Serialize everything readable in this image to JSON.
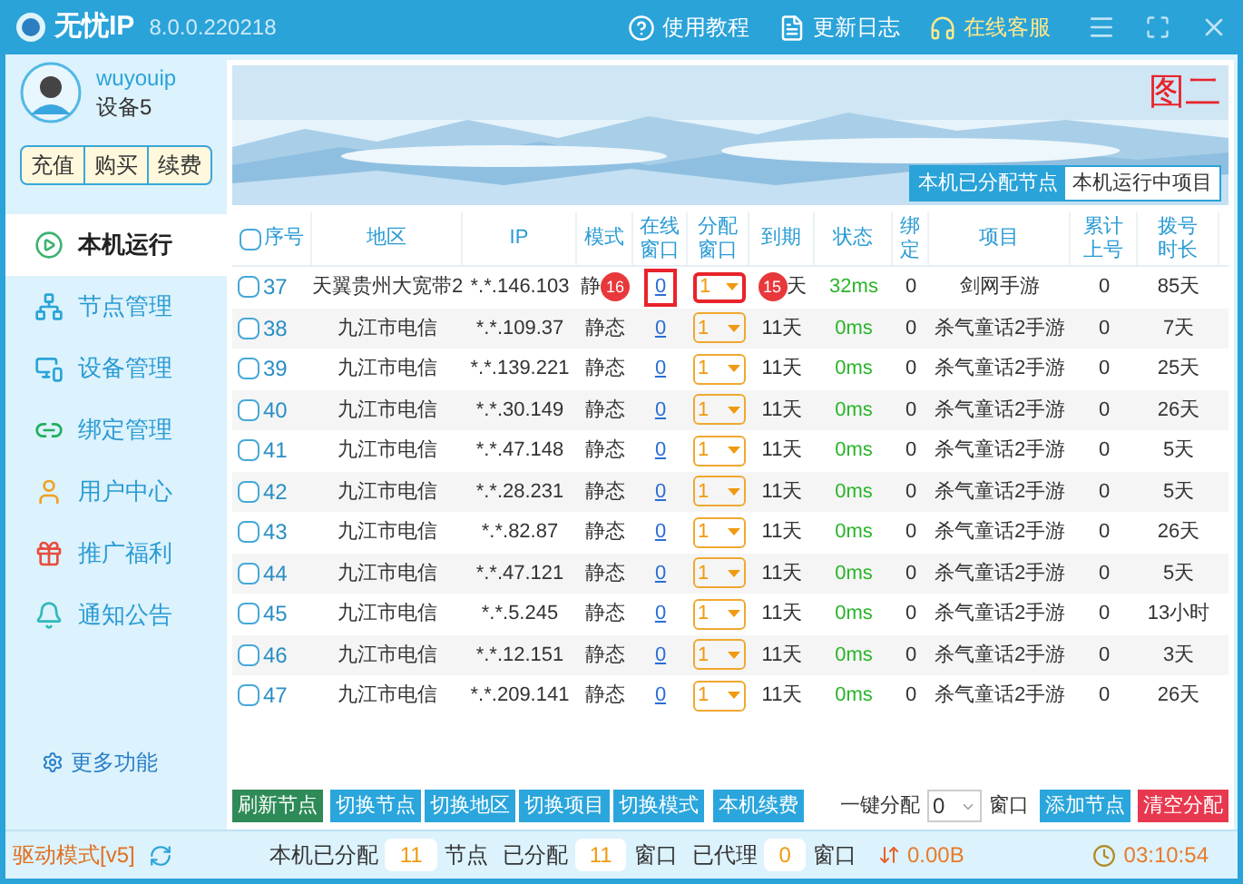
{
  "window": {
    "title": "无忧IP",
    "version": "8.0.0.220218",
    "links": [
      {
        "kind": "help",
        "label": "使用教程"
      },
      {
        "kind": "log",
        "label": "更新日志"
      },
      {
        "kind": "service",
        "label": "在线客服"
      }
    ]
  },
  "user": {
    "name": "wuyouip",
    "device": "设备5",
    "actions": [
      "充值",
      "购买",
      "续费"
    ]
  },
  "sidebar": {
    "items": [
      {
        "kind": "play",
        "label": "本机运行",
        "selected": true
      },
      {
        "kind": "nodes",
        "label": "节点管理",
        "selected": false
      },
      {
        "kind": "device",
        "label": "设备管理",
        "selected": false
      },
      {
        "kind": "bind",
        "label": "绑定管理",
        "selected": false
      },
      {
        "kind": "user",
        "label": "用户中心",
        "selected": false
      },
      {
        "kind": "gift",
        "label": "推广福利",
        "selected": false
      },
      {
        "kind": "bell",
        "label": "通知公告",
        "selected": false
      }
    ],
    "more": "更多功能"
  },
  "banner": {
    "note": "图二",
    "tabs": [
      {
        "label": "本机已分配节点",
        "selected": true
      },
      {
        "label": "本机运行中项目",
        "selected": false
      }
    ]
  },
  "table": {
    "select_all": {
      "checked": false
    },
    "columns": [
      "序号",
      "地区",
      "IP",
      "模式",
      "在线窗口",
      "分配窗口",
      "到期",
      "状态",
      "绑定",
      "项目",
      "累计上号",
      "拨号时长"
    ],
    "rows": [
      {
        "checked": false,
        "highlighted": true,
        "callouts": [
          "16",
          "15"
        ],
        "cells": [
          "37",
          "天翼贵州大宽带2",
          "*.*.146.103",
          "静",
          "0",
          "1",
          "天",
          "32ms",
          "0",
          "剑网手游",
          "0",
          "85天"
        ]
      },
      {
        "checked": false,
        "highlighted": false,
        "cells": [
          "38",
          "九江市电信",
          "*.*.109.37",
          "静态",
          "0",
          "1",
          "11天",
          "0ms",
          "0",
          "杀气童话2手游",
          "0",
          "7天"
        ]
      },
      {
        "checked": false,
        "highlighted": false,
        "cells": [
          "39",
          "九江市电信",
          "*.*.139.221",
          "静态",
          "0",
          "1",
          "11天",
          "0ms",
          "0",
          "杀气童话2手游",
          "0",
          "25天"
        ]
      },
      {
        "checked": false,
        "highlighted": false,
        "cells": [
          "40",
          "九江市电信",
          "*.*.30.149",
          "静态",
          "0",
          "1",
          "11天",
          "0ms",
          "0",
          "杀气童话2手游",
          "0",
          "26天"
        ]
      },
      {
        "checked": false,
        "highlighted": false,
        "cells": [
          "41",
          "九江市电信",
          "*.*.47.148",
          "静态",
          "0",
          "1",
          "11天",
          "0ms",
          "0",
          "杀气童话2手游",
          "0",
          "5天"
        ]
      },
      {
        "checked": false,
        "highlighted": false,
        "cells": [
          "42",
          "九江市电信",
          "*.*.28.231",
          "静态",
          "0",
          "1",
          "11天",
          "0ms",
          "0",
          "杀气童话2手游",
          "0",
          "5天"
        ]
      },
      {
        "checked": false,
        "highlighted": false,
        "cells": [
          "43",
          "九江市电信",
          "*.*.82.87",
          "静态",
          "0",
          "1",
          "11天",
          "0ms",
          "0",
          "杀气童话2手游",
          "0",
          "26天"
        ]
      },
      {
        "checked": false,
        "highlighted": false,
        "cells": [
          "44",
          "九江市电信",
          "*.*.47.121",
          "静态",
          "0",
          "1",
          "11天",
          "0ms",
          "0",
          "杀气童话2手游",
          "0",
          "5天"
        ]
      },
      {
        "checked": false,
        "highlighted": false,
        "cells": [
          "45",
          "九江市电信",
          "*.*.5.245",
          "静态",
          "0",
          "1",
          "11天",
          "0ms",
          "0",
          "杀气童话2手游",
          "0",
          "13小时"
        ]
      },
      {
        "checked": false,
        "highlighted": false,
        "cells": [
          "46",
          "九江市电信",
          "*.*.12.151",
          "静态",
          "0",
          "1",
          "11天",
          "0ms",
          "0",
          "杀气童话2手游",
          "0",
          "3天"
        ]
      },
      {
        "checked": false,
        "highlighted": false,
        "cells": [
          "47",
          "九江市电信",
          "*.*.209.141",
          "静态",
          "0",
          "1",
          "11天",
          "0ms",
          "0",
          "杀气童话2手游",
          "0",
          "26天"
        ]
      }
    ]
  },
  "toolbar": {
    "buttons": [
      {
        "color": "#2e8b57",
        "label": "刷新节点"
      },
      {
        "color": "#2ba6dc",
        "label": "切换节点"
      },
      {
        "color": "#2ba6dc",
        "label": "切换地区"
      },
      {
        "color": "#2ba6dc",
        "label": "切换项目"
      },
      {
        "color": "#2ba6dc",
        "label": "切换模式"
      },
      {
        "color": "#2ba6dc",
        "label": "本机续费"
      }
    ],
    "assign_label": "一键分配",
    "assign_value": "0",
    "assign_unit": "窗口",
    "right_buttons": [
      {
        "color": "#2ba6dc",
        "label": "添加节点"
      },
      {
        "color": "#e8384f",
        "label": "清空分配"
      }
    ]
  },
  "status_bar": {
    "mode": "驱动模式[v5]",
    "stats": [
      {
        "label": "本机已分配",
        "value": "11",
        "unit": "节点"
      },
      {
        "label": "已分配",
        "value": "11",
        "unit": "窗口"
      },
      {
        "label": "已代理",
        "value": "0",
        "unit": "窗口"
      }
    ],
    "speed": "0.00B",
    "time": "03:10:54"
  }
}
